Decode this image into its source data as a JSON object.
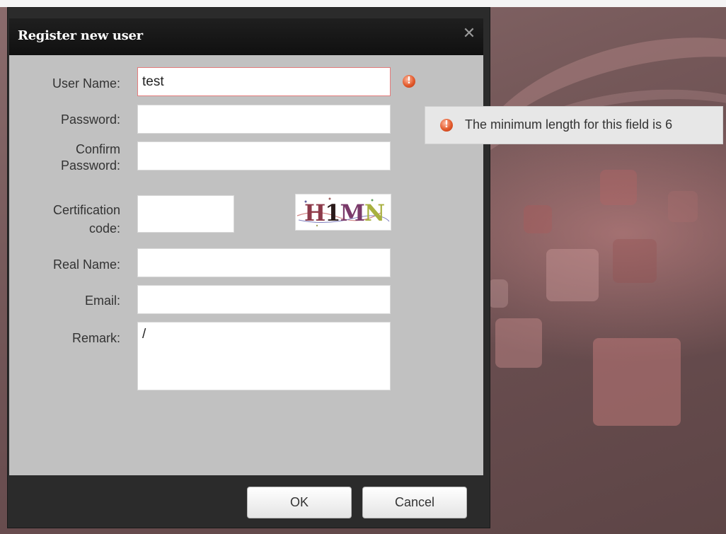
{
  "dialog": {
    "title": "Register new user",
    "close_icon": "close-icon"
  },
  "form": {
    "username_label": "User Name:",
    "username_value": "test",
    "password_label": "Password:",
    "password_value": "",
    "confirm_label_line1": "Confirm",
    "confirm_label_line2": "Password:",
    "confirm_value": "",
    "cert_label_line1": "Certification",
    "cert_label_line2": "code:",
    "cert_value": "",
    "captcha_chars": [
      "H",
      "1",
      "M",
      "N"
    ],
    "realname_label": "Real Name:",
    "realname_value": "",
    "email_label": "Email:",
    "email_value": "",
    "remark_label": "Remark:",
    "remark_value": "/"
  },
  "validation": {
    "icon": "error-icon",
    "icon_glyph": "!",
    "message": "The minimum length for this field is 6"
  },
  "buttons": {
    "ok_label": "OK",
    "cancel_label": "Cancel"
  },
  "colors": {
    "error_border": "#e47b7b",
    "error_icon": "#e25a2c",
    "dialog_dark": "#2b2b2b",
    "form_bg": "#c1c1c1"
  }
}
